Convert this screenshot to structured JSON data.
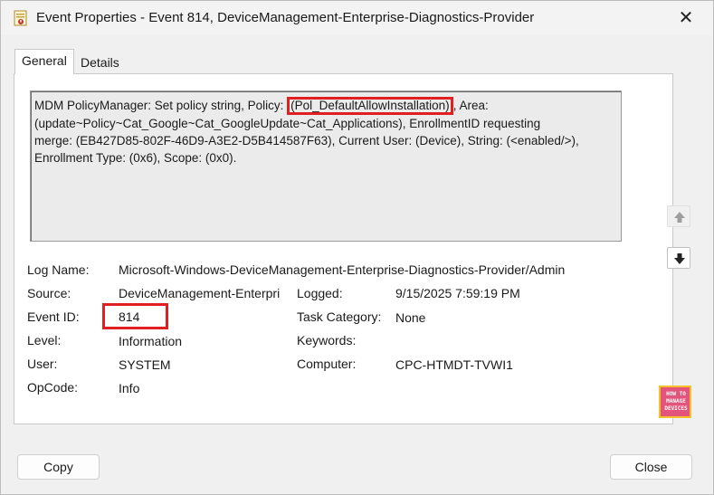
{
  "window": {
    "title": "Event Properties - Event 814, DeviceManagement-Enterprise-Diagnostics-Provider",
    "close_glyph": "✕"
  },
  "tabs": [
    {
      "label": "General",
      "active": true
    },
    {
      "label": "Details",
      "active": false
    }
  ],
  "description": {
    "line1_before": "MDM PolicyManager: Set policy string, Policy: ",
    "line1_policy": "(Pol_DefaultAllowInstallation)",
    "line1_after": ", Area:",
    "line2": "(update~Policy~Cat_Google~Cat_GoogleUpdate~Cat_Applications), EnrollmentID requesting",
    "line3": "merge: (EB427D85-802F-46D9-A3E2-D5B414587F63), Current User: (Device), String: (<enabled/>),",
    "line4": "Enrollment Type: (0x6), Scope: (0x0)."
  },
  "fields": {
    "log_name_label": "Log Name:",
    "log_name_value": "Microsoft-Windows-DeviceManagement-Enterprise-Diagnostics-Provider/Admin",
    "source_label": "Source:",
    "source_value": "DeviceManagement-Enterpri",
    "logged_label": "Logged:",
    "logged_value": "9/15/2025 7:59:19 PM",
    "event_id_label": "Event ID:",
    "event_id_value": "814",
    "task_category_label": "Task Category:",
    "task_category_value": "None",
    "level_label": "Level:",
    "level_value": "Information",
    "keywords_label": "Keywords:",
    "keywords_value": "",
    "user_label": "User:",
    "user_value": "SYSTEM",
    "computer_label": "Computer:",
    "computer_value": "CPC-HTMDT-TVWI1",
    "opcode_label": "OpCode:",
    "opcode_value": "Info"
  },
  "badge": {
    "text": "HOW TO MANAGE DEVICES"
  },
  "buttons": {
    "copy": "Copy",
    "close": "Close"
  },
  "colors": {
    "highlight": "#e02020",
    "badge": "#e4537a",
    "badge_border": "#f3c12c"
  },
  "icons": {
    "app": "event-viewer-icon",
    "up": "arrow-up-icon",
    "down": "arrow-down-icon",
    "close": "close-icon"
  }
}
